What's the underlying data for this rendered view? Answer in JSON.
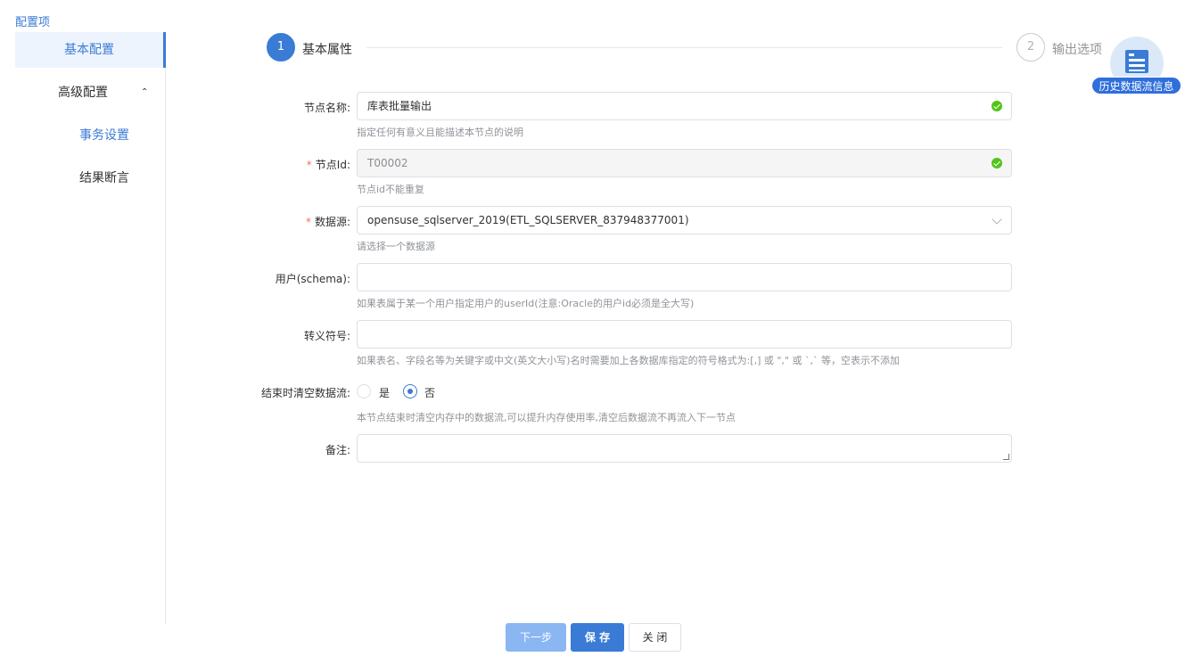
{
  "sidebar": {
    "title": "配置项",
    "items": [
      {
        "label": "基本配置"
      },
      {
        "label": "高级配置"
      },
      {
        "label": "事务设置"
      },
      {
        "label": "结果断言"
      }
    ],
    "collapse_glyph": "⌃"
  },
  "steps": [
    {
      "number": "1",
      "label": "基本属性"
    },
    {
      "number": "2",
      "label": "输出选项"
    }
  ],
  "history": {
    "badge": "历史数据流信息",
    "icon": "document-list-icon"
  },
  "form": {
    "node_name": {
      "label": "节点名称:",
      "value": "库表批量输出",
      "help": "指定任何有意义且能描述本节点的说明"
    },
    "node_id": {
      "required": "*",
      "label": "节点Id:",
      "value": "T00002",
      "help": "节点id不能重复"
    },
    "datasource": {
      "required": "*",
      "label": "数据源:",
      "value": "opensuse_sqlserver_2019(ETL_SQLSERVER_837948377001)",
      "help": "请选择一个数据源"
    },
    "schema": {
      "label": "用户(schema):",
      "value": "",
      "help": "如果表属于某一个用户指定用户的userId(注意:Oracle的用户id必须是全大写)"
    },
    "escape": {
      "label": "转义符号:",
      "value": "",
      "help": "如果表名、字段名等为关键字或中文(英文大小写)名时需要加上各数据库指定的符号格式为:[,] 或 \",\" 或 `,` 等，空表示不添加"
    },
    "clear_stream": {
      "label": "结束时清空数据流:",
      "options": [
        "是",
        "否"
      ],
      "selected": "否",
      "help": "本节点结束时清空内存中的数据流,可以提升内存使用率,清空后数据流不再流入下一节点"
    },
    "remark": {
      "label": "备注:",
      "value": ""
    }
  },
  "buttons": {
    "next": "下一步",
    "save": "保 存",
    "close": "关 闭"
  },
  "colors": {
    "accent": "#3a7bd5",
    "success": "#52c41a",
    "required": "#f56c6c"
  }
}
